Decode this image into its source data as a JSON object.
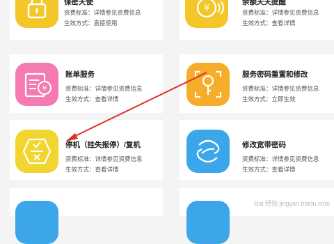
{
  "services": [
    {
      "id": "insurance",
      "title": "保密天使",
      "fee_label": "资费标准：",
      "fee_value": "详情参见资费信息",
      "mode_label": "生效方式：",
      "mode_value": "直接使用",
      "color": "#f3c72a",
      "icon": "lock-icon"
    },
    {
      "id": "balance",
      "title": "余额天天提醒",
      "fee_label": "资费标准：",
      "fee_value": "详情参见资费信息",
      "mode_label": "生效方式：",
      "mode_value": "查看详情",
      "color": "#f3c72a",
      "icon": "yen-coin-icon"
    },
    {
      "id": "bill",
      "title": "账单服务",
      "fee_label": "资费标准：",
      "fee_value": "详情参见资费信息",
      "mode_label": "生效方式：",
      "mode_value": "查看详情",
      "color": "#f57ab1",
      "icon": "bill-icon"
    },
    {
      "id": "password",
      "title": "服务密码重置和修改",
      "fee_label": "资费标准：",
      "fee_value": "详情参见资费信息",
      "mode_label": "生效方式：",
      "mode_value": "立即生效",
      "color": "#f6ad2a",
      "icon": "key-icon"
    },
    {
      "id": "suspend",
      "title": "停机（挂失报停）/复机",
      "fee_label": "资费标准：",
      "fee_value": "详情参见资费信息",
      "mode_label": "生效方式：",
      "mode_value": "查看详情",
      "color": "#f2d52f",
      "icon": "suspend-resume-icon"
    },
    {
      "id": "broadband",
      "title": "修改宽带密码",
      "fee_label": "资费标准：",
      "fee_value": "详情参见资费信息",
      "mode_label": "生效方式：",
      "mode_value": "查看详情",
      "color": "#3ba6ea",
      "icon": "china-mobile-logo-icon"
    }
  ],
  "watermark": "Bai 经验 jingyan.baidu.com",
  "arrow_color": "#e0302a"
}
